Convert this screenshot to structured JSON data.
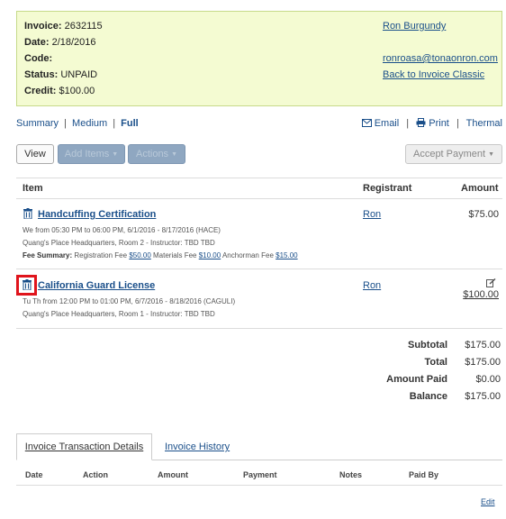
{
  "summary": {
    "invoice_label": "Invoice:",
    "invoice_value": "2632115",
    "date_label": "Date:",
    "date_value": "2/18/2016",
    "code_label": "Code:",
    "code_value": "",
    "status_label": "Status:",
    "status_value": "UNPAID",
    "credit_label": "Credit:",
    "credit_value": "$100.00",
    "customer_name": "Ron Burgundy",
    "customer_email": "ronroasa@tonaonron.com",
    "back_link": "Back to Invoice Classic"
  },
  "views": {
    "summary": "Summary",
    "medium": "Medium",
    "full": "Full",
    "sep": "|"
  },
  "print": {
    "email": "Email",
    "print": "Print",
    "thermal": "Thermal",
    "sep": "|"
  },
  "toolbar": {
    "view": "View",
    "add_items": "Add Items",
    "actions": "Actions",
    "accept_payment": "Accept Payment"
  },
  "table": {
    "headers": {
      "item": "Item",
      "registrant": "Registrant",
      "amount": "Amount"
    },
    "rows": [
      {
        "title": "Handcuffing Certification",
        "line1": "We from 05:30 PM to 06:00 PM, 6/1/2016 - 8/17/2016 (HACE)",
        "line2": "Quang's Place Headquarters, Room 2 - Instructor: TBD TBD",
        "fee_label": "Fee Summary:",
        "fees": [
          {
            "name": "Registration Fee",
            "amount": "$50.00"
          },
          {
            "name": "Materials Fee",
            "amount": "$10.00"
          },
          {
            "name": "Anchorman Fee",
            "amount": "$15.00"
          }
        ],
        "registrant": "Ron",
        "amount": "$75.00"
      },
      {
        "title": "California Guard License",
        "line1": "Tu Th from 12:00 PM to 01:00 PM, 6/7/2016 - 8/18/2016 (CAGULI)",
        "line2": "Quang's Place Headquarters, Room 1 - Instructor: TBD TBD",
        "registrant": "Ron",
        "amount": "$100.00"
      }
    ]
  },
  "totals": {
    "subtotal_label": "Subtotal",
    "subtotal": "$175.00",
    "total_label": "Total",
    "total": "$175.00",
    "paid_label": "Amount Paid",
    "paid": "$0.00",
    "balance_label": "Balance",
    "balance": "$175.00"
  },
  "tabs": {
    "transactions": "Invoice Transaction Details",
    "history": "Invoice History"
  },
  "transactions": {
    "headers": {
      "date": "Date",
      "action": "Action",
      "amount": "Amount",
      "payment": "Payment",
      "notes": "Notes",
      "paid_by": "Paid By"
    },
    "edit": "Edit"
  },
  "colors": {
    "summary_bg": "#f4fbd2",
    "link": "#1a4f8a",
    "disabled_button": "#8fa7c1",
    "highlight": "#e0141c"
  },
  "icons": [
    "envelope-icon",
    "print-icon",
    "trash-icon",
    "edit-icon",
    "caret-down-icon"
  ]
}
